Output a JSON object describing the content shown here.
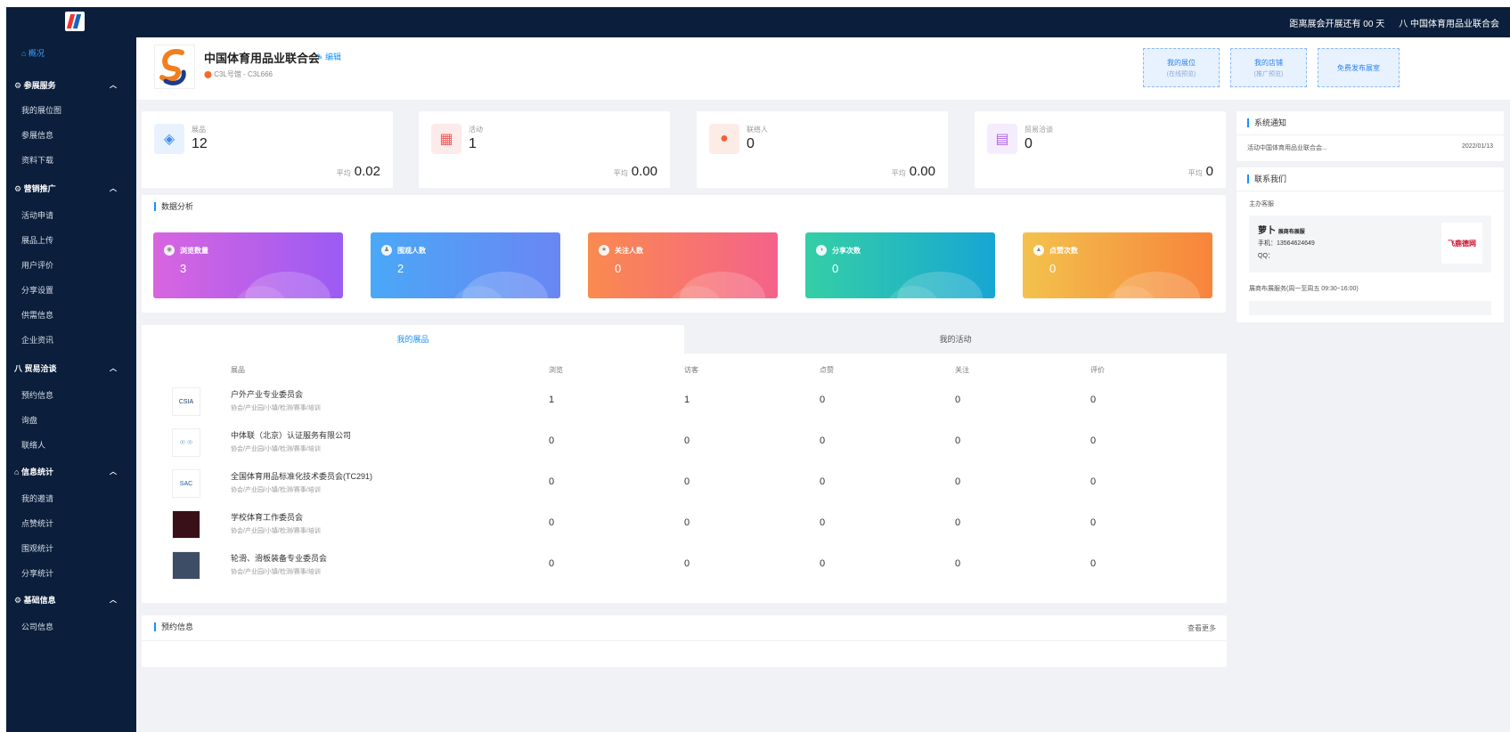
{
  "topbar": {
    "notice": "距离展会开展还有 00 天",
    "account": "中国体育用品业联合会"
  },
  "sidebar": {
    "items": [
      {
        "label": "⌂ 概况",
        "type": "active"
      },
      {
        "label": "参展服务",
        "type": "group",
        "icon": "⚙"
      },
      {
        "label": "我的展位图",
        "type": "item"
      },
      {
        "label": "参展信息",
        "type": "item"
      },
      {
        "label": "资料下载",
        "type": "item"
      },
      {
        "label": "营销推广",
        "type": "group",
        "icon": "⚙"
      },
      {
        "label": "活动申请",
        "type": "item"
      },
      {
        "label": "展品上传",
        "type": "item"
      },
      {
        "label": "用户评价",
        "type": "item"
      },
      {
        "label": "分享设置",
        "type": "item"
      },
      {
        "label": "供需信息",
        "type": "item"
      },
      {
        "label": "企业资讯",
        "type": "item"
      },
      {
        "label": "贸易洽谈",
        "type": "group",
        "icon": "八"
      },
      {
        "label": "预约信息",
        "type": "item"
      },
      {
        "label": "询盘",
        "type": "item"
      },
      {
        "label": "联络人",
        "type": "item"
      },
      {
        "label": "信息统计",
        "type": "group",
        "icon": "⌂"
      },
      {
        "label": "我的邀请",
        "type": "item"
      },
      {
        "label": "点赞统计",
        "type": "item"
      },
      {
        "label": "围观统计",
        "type": "item"
      },
      {
        "label": "分享统计",
        "type": "item"
      },
      {
        "label": "基础信息",
        "type": "group",
        "icon": "⚙"
      },
      {
        "label": "公司信息",
        "type": "item"
      }
    ]
  },
  "company": {
    "name": "中国体育用品业联合会",
    "edit_label": "编辑",
    "booth": "C3L号馆 - C3L666",
    "actions": [
      {
        "label": "我的展位",
        "sub": "(在线预览)"
      },
      {
        "label": "我的店铺",
        "sub": "(推广预览)"
      },
      {
        "label": "免费发布展室",
        "sub": ""
      }
    ]
  },
  "stats": [
    {
      "label": "展品",
      "value": "12",
      "avg_label": "平均",
      "avg": "0.02",
      "icon": "cube-icon",
      "icon_glyph": "◈",
      "color": "#3b8cf5",
      "bg": "#e8f2fe"
    },
    {
      "label": "活动",
      "value": "1",
      "avg_label": "平均",
      "avg": "0.00",
      "icon": "gift-icon",
      "icon_glyph": "▦",
      "color": "#f25a5a",
      "bg": "#fdeaea"
    },
    {
      "label": "联络人",
      "value": "0",
      "avg_label": "平均",
      "avg": "0.00",
      "icon": "user-icon",
      "icon_glyph": "●",
      "color": "#f0603c",
      "bg": "#fdece6"
    },
    {
      "label": "贸易洽谈",
      "value": "0",
      "avg_label": "平均",
      "avg": "0",
      "icon": "chat-icon",
      "icon_glyph": "▤",
      "color": "#b067e8",
      "bg": "#f5ecfd"
    }
  ],
  "analysis": {
    "title": "数据分析",
    "metrics": [
      {
        "label": "浏览数量",
        "value": "3",
        "icon": "eye-icon",
        "glyph": "◉",
        "gradient": "linear-gradient(90deg,#d865e0,#9b5bf3)"
      },
      {
        "label": "围观人数",
        "value": "2",
        "icon": "people-icon",
        "glyph": "♟",
        "gradient": "linear-gradient(90deg,#4aa8f7,#6a86f3)"
      },
      {
        "label": "关注人数",
        "value": "0",
        "icon": "star-icon",
        "glyph": "★",
        "gradient": "linear-gradient(90deg,#fa8a4f,#f5628a)"
      },
      {
        "label": "分享次数",
        "value": "0",
        "icon": "share-icon",
        "glyph": "◑",
        "gradient": "linear-gradient(90deg,#34cfa6,#17a6d3)"
      },
      {
        "label": "点赞次数",
        "value": "0",
        "icon": "thumb-icon",
        "glyph": "▲",
        "gradient": "linear-gradient(90deg,#f3c24c,#f7843c)"
      }
    ]
  },
  "exhibits": {
    "tabs": [
      "我的展品",
      "我的活动"
    ],
    "headers": [
      "展品",
      "浏览",
      "访客",
      "点赞",
      "关注",
      "评价"
    ],
    "rows": [
      {
        "thumb": "CSIA",
        "thumb_bg": "#ffffff",
        "thumb_color": "#1c3c6b",
        "name": "户外产业专业委员会",
        "desc": "协会/产业园/小镇/检测/赛事/培训",
        "values": [
          "1",
          "1",
          "0",
          "0",
          "0"
        ]
      },
      {
        "thumb": "☉ ☉",
        "thumb_bg": "#ffffff",
        "thumb_color": "#1c5aa8",
        "name": "中体联（北京）认证服务有限公司",
        "desc": "协会/产业园/小镇/检测/赛事/培训",
        "values": [
          "0",
          "0",
          "0",
          "0",
          "0"
        ]
      },
      {
        "thumb": "SAC",
        "thumb_bg": "#ffffff",
        "thumb_color": "#1c5aa8",
        "name": "全国体育用品标准化技术委员会(TC291)",
        "desc": "协会/产业园/小镇/检测/赛事/培训",
        "values": [
          "0",
          "0",
          "0",
          "0",
          "0"
        ]
      },
      {
        "thumb": "",
        "thumb_bg": "#3a1018",
        "thumb_color": "#ffffff",
        "name": "学校体育工作委员会",
        "desc": "协会/产业园/小镇/检测/赛事/培训",
        "values": [
          "0",
          "0",
          "0",
          "0",
          "0"
        ]
      },
      {
        "thumb": "",
        "thumb_bg": "#3e4d66",
        "thumb_color": "#ffffff",
        "name": "轮滑、滑板装备专业委员会",
        "desc": "协会/产业园/小镇/检测/赛事/培训",
        "values": [
          "0",
          "0",
          "0",
          "0",
          "0"
        ]
      }
    ]
  },
  "appointments": {
    "title": "预约信息",
    "more": "查看更多"
  },
  "notice": {
    "title": "系统通知",
    "item_text": "活动中国体育用品业联合会...",
    "item_date": "2022/01/13"
  },
  "contact": {
    "title": "联系我们",
    "service_label": "主办客服",
    "name": "萝卜",
    "role": "展商布展服",
    "phone": "手机：13564624649",
    "qq": "QQ：",
    "brand": "飞鹿德网",
    "hours": "展商布展服务(周一至周五 09:30~16:00)"
  }
}
